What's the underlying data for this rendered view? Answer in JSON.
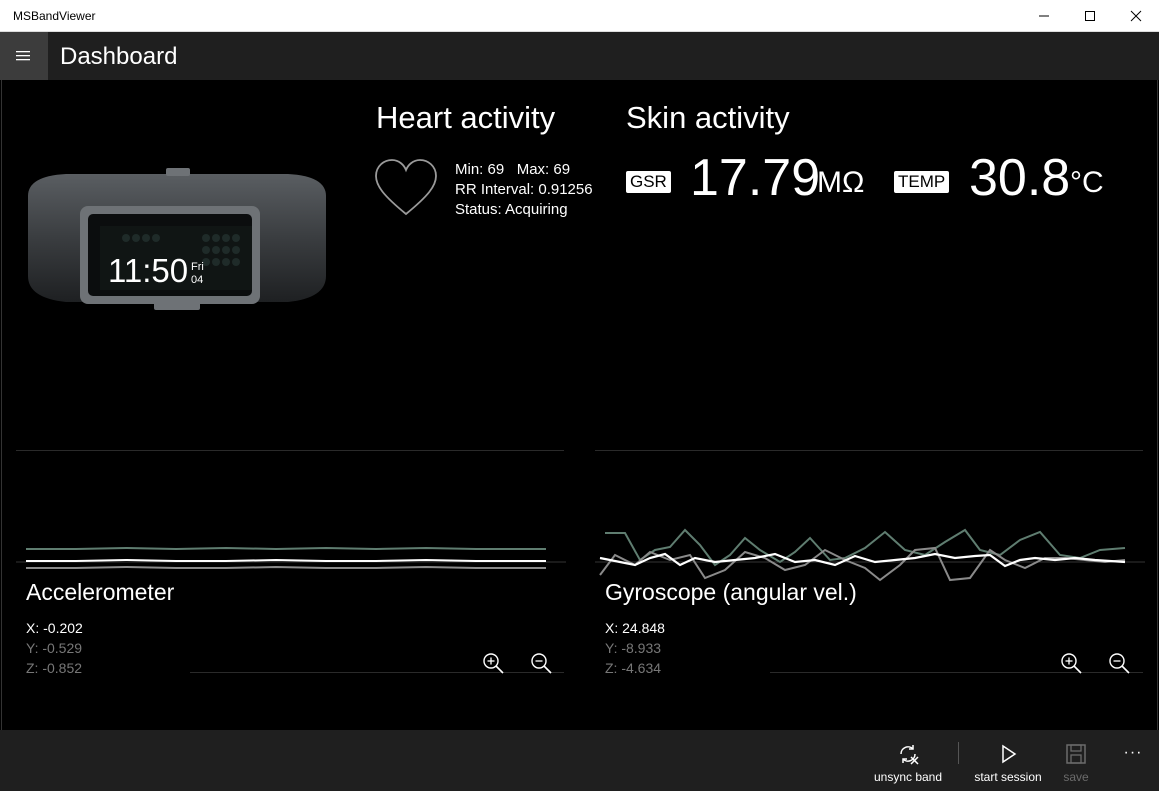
{
  "window": {
    "title": "MSBandViewer"
  },
  "appbar": {
    "title": "Dashboard"
  },
  "band": {
    "time": "11:50",
    "day": "Fri",
    "date": "04"
  },
  "heart": {
    "title": "Heart activity",
    "min_label": "Min: 69",
    "max_label": "Max: 69",
    "rr_label": "RR Interval: 0.91256",
    "status_label": "Status: Acquiring"
  },
  "skin": {
    "title": "Skin activity",
    "gsr_badge": "GSR",
    "gsr_value": "17.79",
    "gsr_unit": "MΩ",
    "temp_badge": "TEMP",
    "temp_value": "30.8",
    "temp_unit": "°C"
  },
  "accelerometer": {
    "title": "Accelerometer",
    "x": "X: -0.202",
    "y": "Y: -0.529",
    "z": "Z: -0.852"
  },
  "gyroscope": {
    "title": "Gyroscope (angular vel.)",
    "x": "X: 24.848",
    "y": "Y: -8.933",
    "z": "Z: -4.634"
  },
  "commands": {
    "unsync": "unsync band",
    "start": "start session",
    "save": "save",
    "more": "···"
  },
  "colors": {
    "x_series": "#ffffff",
    "y_series": "#8a8a8a",
    "z_series": "#5f7d70",
    "accent_disabled": "#6b6b6b"
  },
  "icons": [
    "hamburger-icon",
    "heart-icon",
    "zoom-in-icon",
    "zoom-out-icon",
    "sync-off-icon",
    "play-icon",
    "save-icon",
    "more-icon"
  ]
}
